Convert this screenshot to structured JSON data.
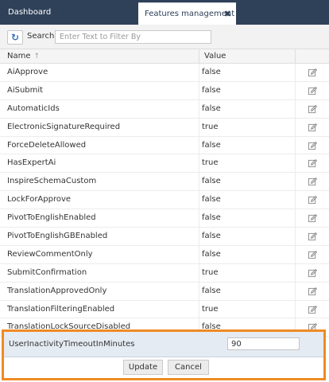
{
  "tabs": {
    "dashboard": "Dashboard",
    "features": "Features management",
    "close_glyph": "✖"
  },
  "toolbar": {
    "refresh_icon": "refresh-icon",
    "search_label": "Search:",
    "search_placeholder": "Enter Text to Filter By",
    "search_value": ""
  },
  "grid": {
    "headers": {
      "name": "Name",
      "value": "Value",
      "sort_glyph": "↑"
    },
    "rows": [
      {
        "name": "AiApprove",
        "value": "false"
      },
      {
        "name": "AiSubmit",
        "value": "false"
      },
      {
        "name": "AutomaticIds",
        "value": "false"
      },
      {
        "name": "ElectronicSignatureRequired",
        "value": "true"
      },
      {
        "name": "ForceDeleteAllowed",
        "value": "false"
      },
      {
        "name": "HasExpertAi",
        "value": "true"
      },
      {
        "name": "InspireSchemaCustom",
        "value": "false"
      },
      {
        "name": "LockForApprove",
        "value": "false"
      },
      {
        "name": "PivotToEnglishEnabled",
        "value": "false"
      },
      {
        "name": "PivotToEnglishGBEnabled",
        "value": "false"
      },
      {
        "name": "ReviewCommentOnly",
        "value": "false"
      },
      {
        "name": "SubmitConfirmation",
        "value": "true"
      },
      {
        "name": "TranslationApprovedOnly",
        "value": "false"
      },
      {
        "name": "TranslationFilteringEnabled",
        "value": "true"
      },
      {
        "name": "TranslationLockSourceDisabled",
        "value": "false"
      }
    ]
  },
  "edit_row": {
    "name": "UserInactivityTimeoutInMinutes",
    "value": "90",
    "update_label": "Update",
    "cancel_label": "Cancel"
  },
  "colors": {
    "tabbar": "#2f4159",
    "highlight_border": "#f08a24",
    "edit_row_bg": "#e5ebf2",
    "refresh_icon": "#3a6fb5"
  }
}
